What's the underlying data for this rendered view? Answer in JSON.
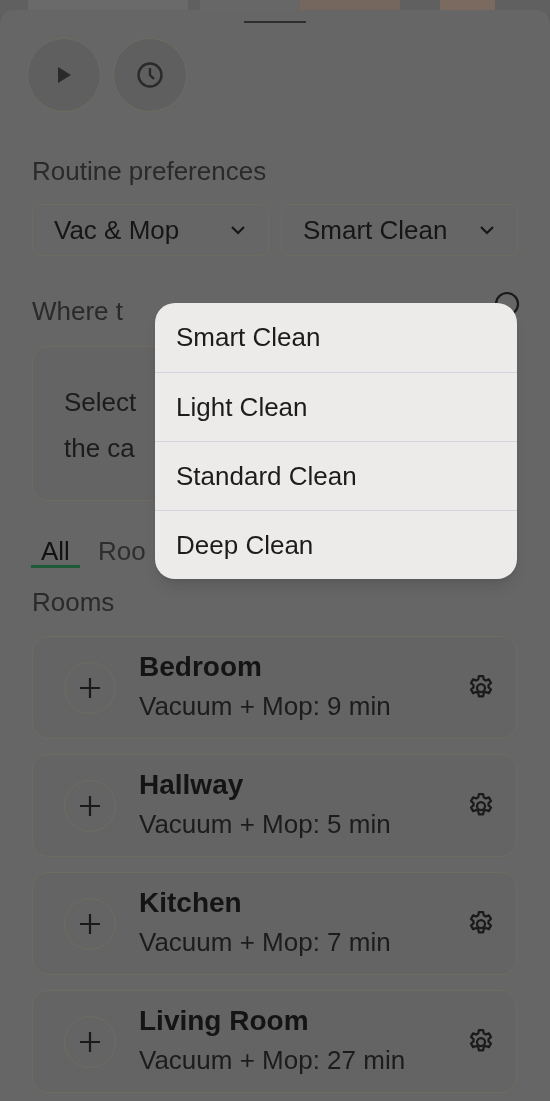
{
  "sheet": {
    "actions": [
      {
        "kind": "play"
      },
      {
        "kind": "schedule"
      }
    ],
    "preferences_heading": "Routine preferences",
    "dropdowns": [
      {
        "value": "Vac & Mop"
      },
      {
        "value": "Smart Clean"
      }
    ],
    "where_heading": "Where t",
    "info_card": {
      "lines": [
        "Select",
        "the ca"
      ]
    },
    "tabs": [
      {
        "label": "All",
        "selected": true
      },
      {
        "label": "Roo",
        "selected": false
      }
    ],
    "rooms_heading": "Rooms",
    "rooms": [
      {
        "name": "Bedroom",
        "detail": "Vacuum + Mop: 9 min"
      },
      {
        "name": "Hallway",
        "detail": "Vacuum + Mop: 5 min"
      },
      {
        "name": "Kitchen",
        "detail": "Vacuum + Mop: 7 min"
      },
      {
        "name": "Living Room",
        "detail": "Vacuum + Mop: 27 min"
      }
    ]
  },
  "menu": {
    "items": [
      {
        "label": "Smart Clean"
      },
      {
        "label": "Light Clean"
      },
      {
        "label": "Standard Clean"
      },
      {
        "label": "Deep Clean"
      }
    ]
  }
}
